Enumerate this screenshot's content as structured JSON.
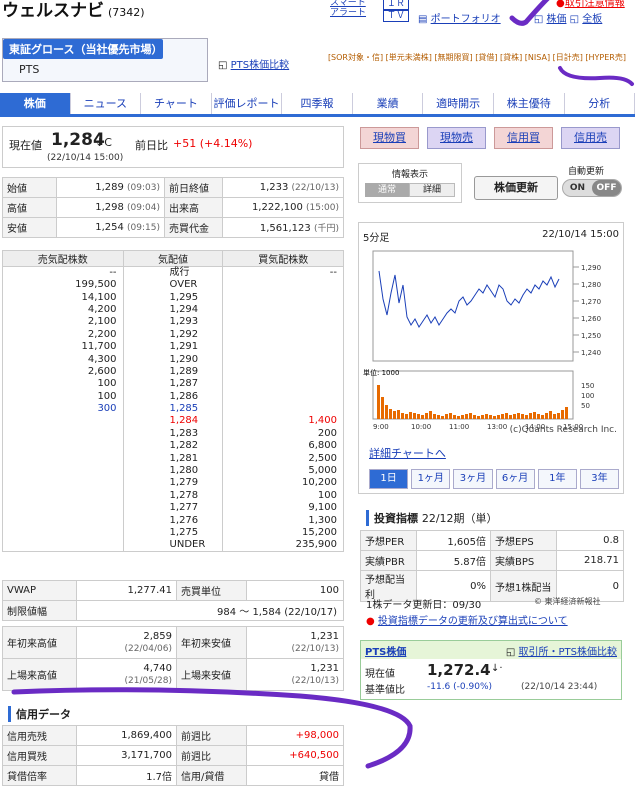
{
  "header": {
    "title": "ウェルスナビ",
    "code": "(7342)",
    "links_a": [
      "スマート",
      "アラート"
    ],
    "links_b": [
      "ＩＲ",
      "ＴＶ"
    ],
    "portfolio": "ポートフォリオ",
    "stock": "株価",
    "all": "全板",
    "caution": "取引注意情報"
  },
  "market": {
    "selected": "東証グロース（当社優先市場）",
    "pts": "PTS",
    "compare": "PTS株価比較",
    "tags": "[SOR対象・信] [単元未満株] [無期限買] [貸借] [貸株] [NISA] [日計売] [HYPER売]"
  },
  "tabs": [
    "株価",
    "ニュース",
    "チャート",
    "評価レポート",
    "四季報",
    "業績",
    "適時開示",
    "株主優待",
    "分析"
  ],
  "price": {
    "label": "現在値",
    "value": "1,284",
    "mark": "↓C",
    "time": "(22/10/14 15:00)",
    "change_label": "前日比",
    "change": "+51 (+4.14%)"
  },
  "stats": [
    [
      "始値",
      "1,289",
      "(09:03)",
      "前日終値",
      "1,233",
      "(22/10/13)"
    ],
    [
      "高値",
      "1,298",
      "(09:04)",
      "出来高",
      "1,222,100",
      "(15:00)"
    ],
    [
      "安値",
      "1,254",
      "(09:15)",
      "売買代金",
      "1,561,123",
      "(千円)"
    ]
  ],
  "board": {
    "headers": [
      "売気配株数",
      "気配値",
      "買気配株数"
    ],
    "rows": [
      [
        "--",
        "成行",
        "--"
      ],
      [
        "199,500",
        "OVER",
        ""
      ],
      [
        "14,100",
        "1,295",
        ""
      ],
      [
        "4,200",
        "1,294",
        ""
      ],
      [
        "2,100",
        "1,293",
        ""
      ],
      [
        "2,200",
        "1,292",
        ""
      ],
      [
        "11,700",
        "1,291",
        ""
      ],
      [
        "4,300",
        "1,290",
        ""
      ],
      [
        "2,600",
        "1,289",
        ""
      ],
      [
        "100",
        "1,287",
        ""
      ],
      [
        "100",
        "1,286",
        ""
      ],
      [
        "300",
        "1,285",
        ""
      ],
      [
        "",
        "1,284",
        "1,400"
      ],
      [
        "",
        "1,283",
        "200"
      ],
      [
        "",
        "1,282",
        "6,800"
      ],
      [
        "",
        "1,281",
        "2,500"
      ],
      [
        "",
        "1,280",
        "5,000"
      ],
      [
        "",
        "1,279",
        "10,200"
      ],
      [
        "",
        "1,278",
        "100"
      ],
      [
        "",
        "1,277",
        "9,100"
      ],
      [
        "",
        "1,276",
        "1,300"
      ],
      [
        "",
        "1,275",
        "15,200"
      ],
      [
        "",
        "UNDER",
        "235,900"
      ]
    ]
  },
  "vwap": [
    [
      "VWAP",
      "1,277.41",
      "売買単位",
      "100"
    ],
    [
      "制限値幅",
      "984 〜 1,584 (22/10/17)"
    ]
  ],
  "yearly": [
    [
      "年初来高値",
      "2,859",
      "(22/04/06)",
      "年初来安値",
      "1,231",
      "(22/10/13)"
    ],
    [
      "上場来高値",
      "4,740",
      "(21/05/28)",
      "上場来安値",
      "1,231",
      "(22/10/13)"
    ]
  ],
  "credit": {
    "title": "信用データ",
    "rows": [
      [
        "信用売残",
        "1,869,400",
        "前週比",
        "+98,000"
      ],
      [
        "信用買残",
        "3,171,700",
        "前週比",
        "+640,500"
      ],
      [
        "貸借倍率",
        "1.7倍",
        "信用/貸借",
        "貸借"
      ]
    ]
  },
  "trade": [
    "現物買",
    "現物売",
    "信用買",
    "信用売"
  ],
  "info": {
    "label": "情報表示",
    "normal": "通常",
    "detail": "詳細",
    "update_btn": "株価更新",
    "auto": "自動更新",
    "on": "ON",
    "off": "OFF"
  },
  "chart": {
    "label": "5分足",
    "time": "22/10/14 15:00",
    "yticks": [
      "1,290",
      "1,280",
      "1,270",
      "1,260",
      "1,250",
      "1,240"
    ],
    "vticks": [
      "150",
      "100",
      "50"
    ],
    "vol_unit": "単位: 1000",
    "xticks": [
      "9:00",
      "10:00",
      "11:00",
      "13:00",
      "14:00",
      "15:00"
    ],
    "credit": "(c)Quants Research Inc.",
    "detail": "詳細チャートへ",
    "periods": [
      "1日",
      "1ヶ月",
      "3ヶ月",
      "6ヶ月",
      "1年",
      "3年"
    ]
  },
  "indicators": {
    "title": "投資指標",
    "period": "22/12期（単）",
    "rows": [
      [
        "予想PER",
        "1,605倍",
        "予想EPS",
        "0.8"
      ],
      [
        "実績PBR",
        "5.87倍",
        "実績BPS",
        "218.71"
      ],
      [
        "予想配当利",
        "0%",
        "予想1株配当",
        "0"
      ]
    ],
    "update": "1株データ更新日：09/30",
    "source": "© 東洋経済新報社",
    "link": "投資指標データの更新及び算出式について"
  },
  "pts": {
    "title": "PTS株価",
    "link": "取引所・PTS株価比較",
    "price_label": "現在値",
    "price": "1,272.4",
    "mark": "↓·",
    "diff_label": "基準値比",
    "diff": "-11.6 (-0.90%)",
    "time": "(22/10/14 23:44)"
  },
  "colors": {
    "accent": "#2e6bd4",
    "annotation": "#6a2bc4",
    "up": "#e00000"
  }
}
